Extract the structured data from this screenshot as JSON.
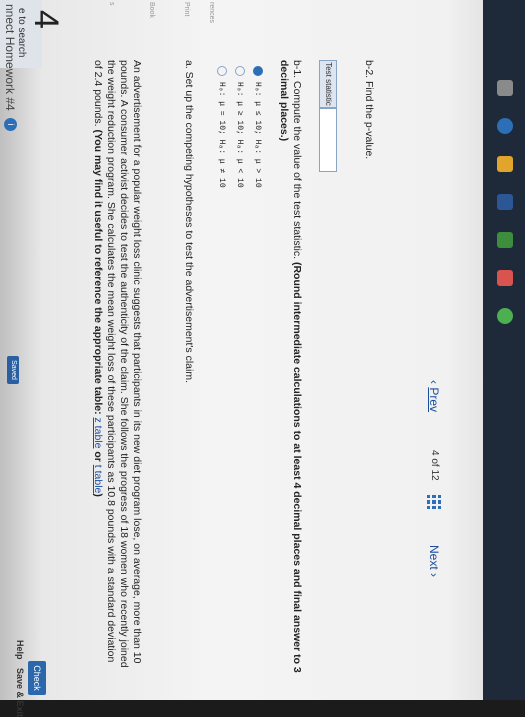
{
  "browser": {
    "url": "mheducation.com/hm.tpx",
    "tab_title": "nnect Homework #4"
  },
  "header": {
    "assignment_title": "nnect Homework #4",
    "info_icon": "i",
    "saved_label": "Saved",
    "help_label": "Help",
    "save_exit_label": "Save & Exit",
    "check_label": "Check"
  },
  "question": {
    "number": "4",
    "paragraph": "An advertisement for a popular weight loss clinic suggests that participants in its new diet program lose, on average, more than 10 pounds. A consumer activist decides to test the authenticity of the claim. She follows the progress of 18 women who recently joined the weight reduction program. She calculates the mean weight loss of these participants as 10.8 pounds with a standard deviation of 2.4 pounds.",
    "hint": "(You may find it useful to reference the appropriate table:",
    "table_link_1": "z table",
    "table_link_or": "or",
    "table_link_2": "t table",
    "hint_close": ")",
    "part_a": "a. Set up the competing hypotheses to test the advertisement's claim.",
    "options": [
      "H₀: μ = 10; Hₐ: μ ≠ 10",
      "H₀: μ ≥ 10; Hₐ: μ < 10",
      "H₀: μ ≤ 10; Hₐ: μ > 10"
    ],
    "selected_option": 2,
    "part_b1": "b-1. Compute the value of the test statistic.",
    "part_b1_round": "(Round intermediate calculations to at least 4 decimal places and final answer to 3 decimal places.)",
    "test_statistic_label": "Test statistic",
    "test_statistic_value": "",
    "part_b2": "b-2. Find the p-value."
  },
  "sidebar": {
    "items": [
      "s",
      "Book",
      "Print",
      "rences"
    ]
  },
  "navigation": {
    "prev_label": "Prev",
    "page_current": "4",
    "page_of": "of",
    "page_total": "12",
    "next_label": "Next"
  },
  "taskbar": {
    "search_label": "e to search"
  },
  "colors": {
    "accent": "#2d6fb7",
    "taskbar": "#1e2a3a"
  }
}
